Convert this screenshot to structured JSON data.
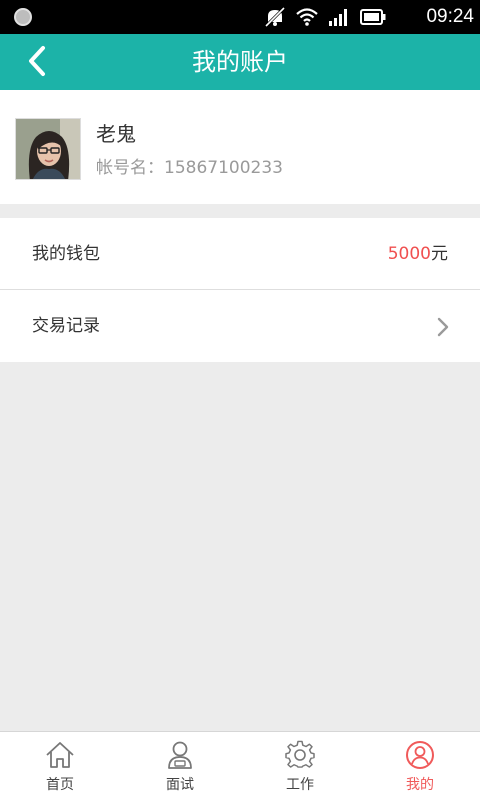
{
  "status_bar": {
    "time": "09:24"
  },
  "header": {
    "title": "我的账户"
  },
  "profile": {
    "name": "老鬼",
    "account_label": "帐号名：",
    "account_number": "15867100233"
  },
  "wallet": {
    "label": "我的钱包",
    "amount": "5000",
    "unit": "元"
  },
  "transactions": {
    "label": "交易记录"
  },
  "tabs": [
    {
      "label": "首页",
      "icon": "home-icon"
    },
    {
      "label": "面试",
      "icon": "person-icon"
    },
    {
      "label": "工作",
      "icon": "gear-icon"
    },
    {
      "label": "我的",
      "icon": "user-circle-icon",
      "active": true
    }
  ],
  "colors": {
    "accent": "#1cb3a8",
    "highlight": "#f05050",
    "background": "#ececec"
  }
}
